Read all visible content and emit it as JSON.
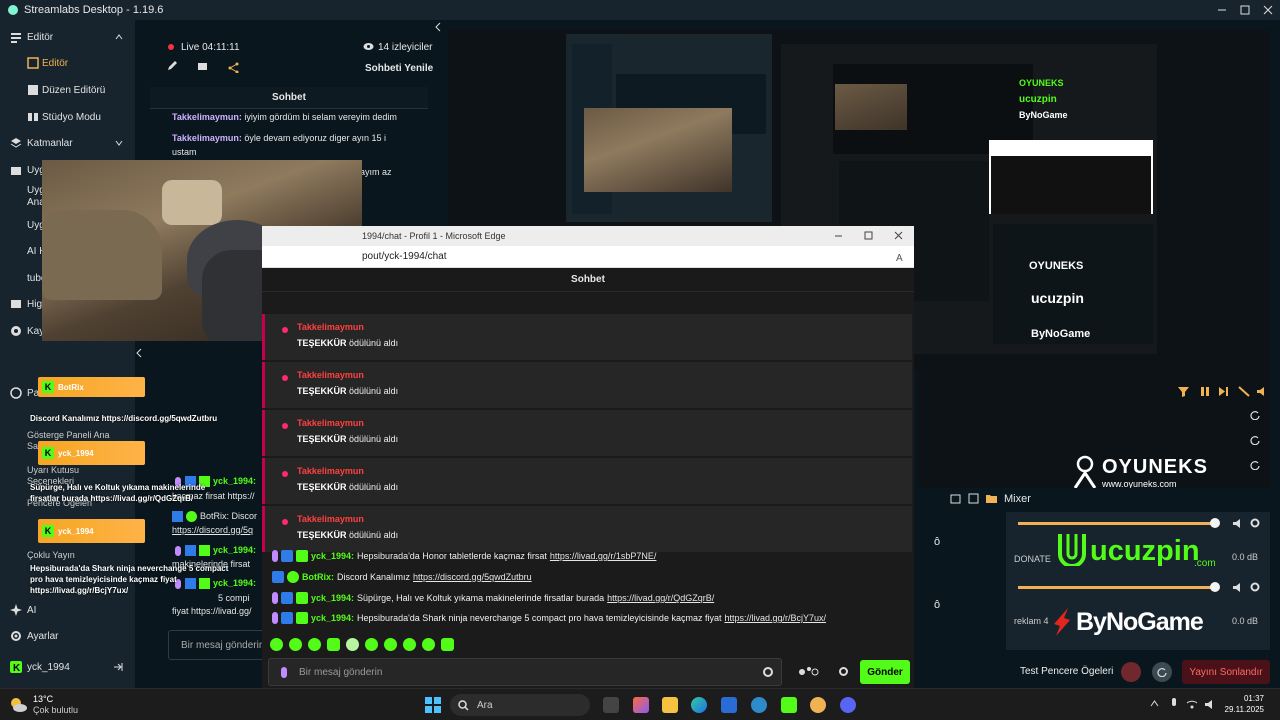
{
  "window": {
    "title": "Streamlabs Desktop - 1.19.6"
  },
  "nav": {
    "editor": "Editör",
    "editor_sub": "Editör",
    "layout_editor": "Düzen Editörü",
    "studio_mode": "Stüdyo Modu",
    "layers": "Katmanlar",
    "apps_partial": "Uyg",
    "apps2_partial": "Uyg",
    "apps3_partial": "Ana",
    "apps4_partial": "Uyg",
    "ai_partial": "AI H",
    "tube_partial": "tube",
    "high_partial": "High",
    "kay_partial": "Kay",
    "panel_partial": "Pa",
    "panel_text": "Gösterge Paneli Ana Sayfa",
    "alert_box": "Uyarı Kutusu Seçenekleri",
    "widgets": "Pencere Öğeleri",
    "multistream": "Çoklu Yayın",
    "ai": "AI",
    "settings": "Ayarlar",
    "user": "yck_1994"
  },
  "stream": {
    "live": "Live 04:11:11",
    "viewers": "14 izleyiciler",
    "refresh_chat": "Sohbeti Yenile",
    "chat_title": "Sohbet",
    "input_placeholder": "Bir mesaj gönderin"
  },
  "side_chat": [
    {
      "user": "Takkelimaymun:",
      "text": "iyiyim gördüm bi selam vereyim dedim"
    },
    {
      "user": "Takkelimaymun:",
      "text": "öyle devam ediyoruz diger ayın 15 i"
    },
    {
      "user": "",
      "text": "ustam"
    },
    {
      "user": "",
      "text": "ayım az"
    }
  ],
  "side_chat_lower": {
    "yck_name": "yck_1994:",
    "kacmaz": "kaçmaz firsat https://",
    "botrix": "BotRix: Discor",
    "discord_partial": "https://discord.gg/5q",
    "yck2": "yck_1994:",
    "makine": "makinelerinde firsat",
    "yck3": "yck_1994:",
    "compi": "5 compi",
    "fiyat": "fiyat https://livad.gg/"
  },
  "alerts": {
    "a1_name": "BotRix",
    "a1_text": "Discord Kanalımız https://discord.gg/5qwdZutbru",
    "a2_name": "yck_1994",
    "a2_text": "Süpürge, Halı ve Koltuk yıkama makinelerinde firsatlar burada https://livad.gg/r/QdGZqrB/",
    "a3_name": "yck_1994",
    "a3_text": "Hepsiburada'da Shark ninja neverchange 5 compact pro hava temizleyicisinde kaçmaz fiyat https://livad.gg/r/BcjY7ux/"
  },
  "edge": {
    "title": "1994/chat - Profil 1 - Microsoft Edge",
    "url": "pout/yck-1994/chat",
    "chat_title": "Sohbet",
    "subs": [
      {
        "name": "Takkelimaymun",
        "reward": "TEŞEKKÜR",
        "suffix": "ödülünü aldı"
      },
      {
        "name": "Takkelimaymun",
        "reward": "TEŞEKKÜR",
        "suffix": "ödülünü aldı"
      },
      {
        "name": "Takkelimaymun",
        "reward": "TEŞEKKÜR",
        "suffix": "ödülünü aldı"
      },
      {
        "name": "Takkelimaymun",
        "reward": "TEŞEKKÜR",
        "suffix": "ödülünü aldı"
      },
      {
        "name": "Takkelimaymun",
        "reward": "TEŞEKKÜR",
        "suffix": "ödülünü aldı"
      }
    ],
    "messages": [
      {
        "user": "yck_1994:",
        "text": "Hepsiburada'da Honor tabletlerde kaçmaz firsat",
        "link": "https://livad.gg/r/1sbP7NE/"
      },
      {
        "user": "BotRix:",
        "text": "Discord Kanalımız",
        "link": "https://discord.gg/5qwdZutbru"
      },
      {
        "user": "yck_1994:",
        "text": "Süpürge, Halı ve Koltuk yıkama makinelerinde firsatlar burada",
        "link": "https://livad.gg/r/QdGZqrB/"
      },
      {
        "user": "yck_1994:",
        "text": "Hepsiburada'da Shark ninja neverchange 5 compact pro hava temizleyicisinde kaçmaz fiyat",
        "link": "https://livad.gg/r/BcjY7ux/"
      }
    ],
    "input_placeholder": "Bir mesaj gönderin",
    "send": "Gönder"
  },
  "mixer": {
    "title": "Mixer",
    "donate": "DONATE",
    "ch1_db": "0.0 dB",
    "ch2_label": "reklam 4",
    "ch2_db": "0.0 dB"
  },
  "brands": {
    "oyuneks": "OYUNEKS",
    "oyuneks_url": "www.oyuneks.com",
    "ucuzpin": "ucuzpin",
    "ucuzpin_com": ".com",
    "bynogame": "ByNoGame"
  },
  "footer": {
    "test_widgets": "Test Pencere Ögeleri",
    "end_stream": "Yayını Sonlandır"
  },
  "taskbar": {
    "temp": "13°C",
    "weather": "Çok bulutlu",
    "search": "Ara",
    "time": "01:37",
    "date": "29.11.2025"
  },
  "colors": {
    "accent": "#80f5d2",
    "live": "#f5333d",
    "send": "#53fc18",
    "end_stream": "#4a1118"
  }
}
